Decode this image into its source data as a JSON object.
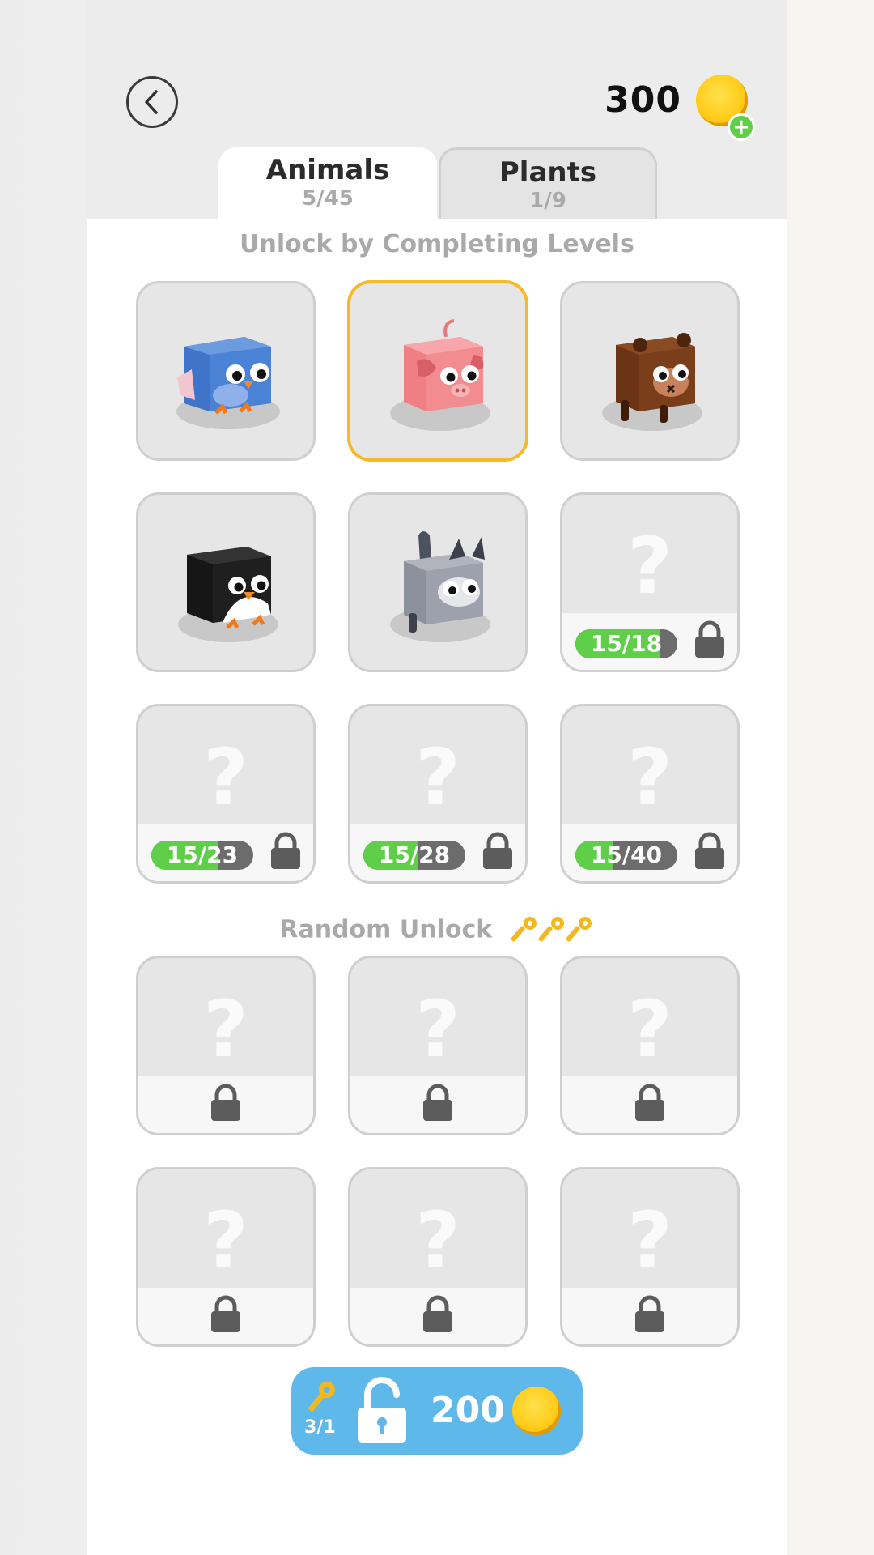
{
  "header": {
    "coins": "300",
    "coin_icon": "coin-icon",
    "add_icon": "plus-icon",
    "back_icon": "chevron-left-icon"
  },
  "tabs": [
    {
      "label": "Animals",
      "count": "5/45",
      "active": true
    },
    {
      "label": "Plants",
      "count": "1/9",
      "active": false
    }
  ],
  "sections": {
    "levels_title": "Unlock by Completing Levels",
    "random_title": "Random Unlock",
    "keys_owned": 3
  },
  "level_items": [
    {
      "name": "blue-bird",
      "unlocked": true,
      "selected": false
    },
    {
      "name": "pig",
      "unlocked": true,
      "selected": true
    },
    {
      "name": "bear",
      "unlocked": true,
      "selected": false
    },
    {
      "name": "penguin",
      "unlocked": true,
      "selected": false
    },
    {
      "name": "cat",
      "unlocked": true,
      "selected": false
    },
    {
      "unlocked": false,
      "progress": "15/18",
      "progress_fraction": 0.833
    },
    {
      "unlocked": false,
      "progress": "15/23",
      "progress_fraction": 0.652
    },
    {
      "unlocked": false,
      "progress": "15/28",
      "progress_fraction": 0.536
    },
    {
      "unlocked": false,
      "progress": "15/40",
      "progress_fraction": 0.375
    }
  ],
  "random_items_count": 6,
  "unknown_symbol": "?",
  "bottom_button": {
    "key_count": "3/1",
    "price": "200",
    "icons": [
      "key-icon",
      "unlock-icon",
      "coin-icon"
    ]
  },
  "colors": {
    "accent_green": "#5fcf4a",
    "button_blue": "#5fb8ea",
    "coin_gold": "#ffcc1a",
    "selected_border": "#f6b92b"
  }
}
